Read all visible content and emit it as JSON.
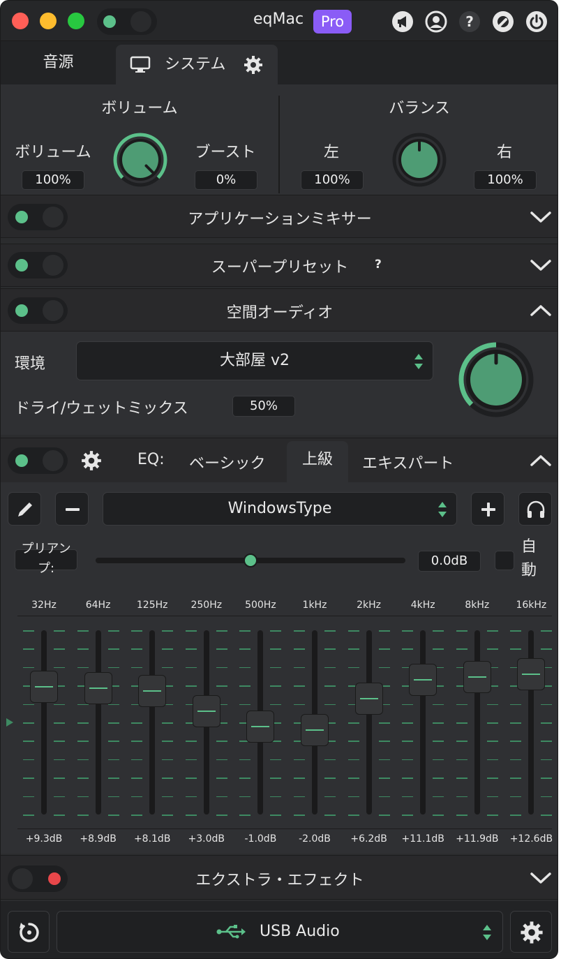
{
  "window": {
    "title": "eqMac",
    "badge": "Pro"
  },
  "titlebar_icons": [
    "megaphone-icon",
    "user-icon",
    "help-icon",
    "settings-wrench-icon",
    "power-icon"
  ],
  "tabs": [
    {
      "label": "音源"
    },
    {
      "label": "システム"
    }
  ],
  "volume": {
    "title": "ボリューム",
    "volume_label": "ボリューム",
    "volume_value": "100%",
    "boost_label": "ブースト",
    "boost_value": "0%",
    "level": 1.0
  },
  "balance": {
    "title": "バランス",
    "left_label": "左",
    "left_value": "100%",
    "right_label": "右",
    "right_value": "100%",
    "position": 0.5
  },
  "app_mixer": {
    "title": "アプリケーションミキサー"
  },
  "super_preset": {
    "title": "スーパープリセット",
    "help": "?"
  },
  "spatial": {
    "title": "空間オーディオ",
    "env_label": "環境",
    "env_value": "大部屋 v2",
    "mix_label": "ドライ/ウェットミックス",
    "mix_value": "50%",
    "mix_level": 0.5
  },
  "eq": {
    "label": "EQ:",
    "modes": [
      {
        "label": "ベーシック"
      },
      {
        "label": "上級"
      },
      {
        "label": "エキスパート"
      }
    ],
    "preset": "WindowsType",
    "preamp_label": "プリアンプ:",
    "preamp_value": "0.0dB",
    "preamp_level": 0.5,
    "auto_label": "自動",
    "bands": [
      {
        "freq": "32Hz",
        "gain": "+9.3dB",
        "db": 9.3
      },
      {
        "freq": "64Hz",
        "gain": "+8.9dB",
        "db": 8.9
      },
      {
        "freq": "125Hz",
        "gain": "+8.1dB",
        "db": 8.1
      },
      {
        "freq": "250Hz",
        "gain": "+3.0dB",
        "db": 3.0
      },
      {
        "freq": "500Hz",
        "gain": "-1.0dB",
        "db": -1.0
      },
      {
        "freq": "1kHz",
        "gain": "-2.0dB",
        "db": -2.0
      },
      {
        "freq": "2kHz",
        "gain": "+6.2dB",
        "db": 6.2
      },
      {
        "freq": "4kHz",
        "gain": "+11.1dB",
        "db": 11.1
      },
      {
        "freq": "8kHz",
        "gain": "+11.9dB",
        "db": 11.9
      },
      {
        "freq": "16kHz",
        "gain": "+12.6dB",
        "db": 12.6
      }
    ]
  },
  "extra": {
    "title": "エクストラ・エフェクト"
  },
  "footer": {
    "device": "USB Audio"
  },
  "colors": {
    "accent": "#5cc08a",
    "red": "#ff5f57",
    "yellow": "#febc2e",
    "green_light": "#28c840",
    "pro": "#8a5cf6",
    "off": "#e8474a"
  }
}
